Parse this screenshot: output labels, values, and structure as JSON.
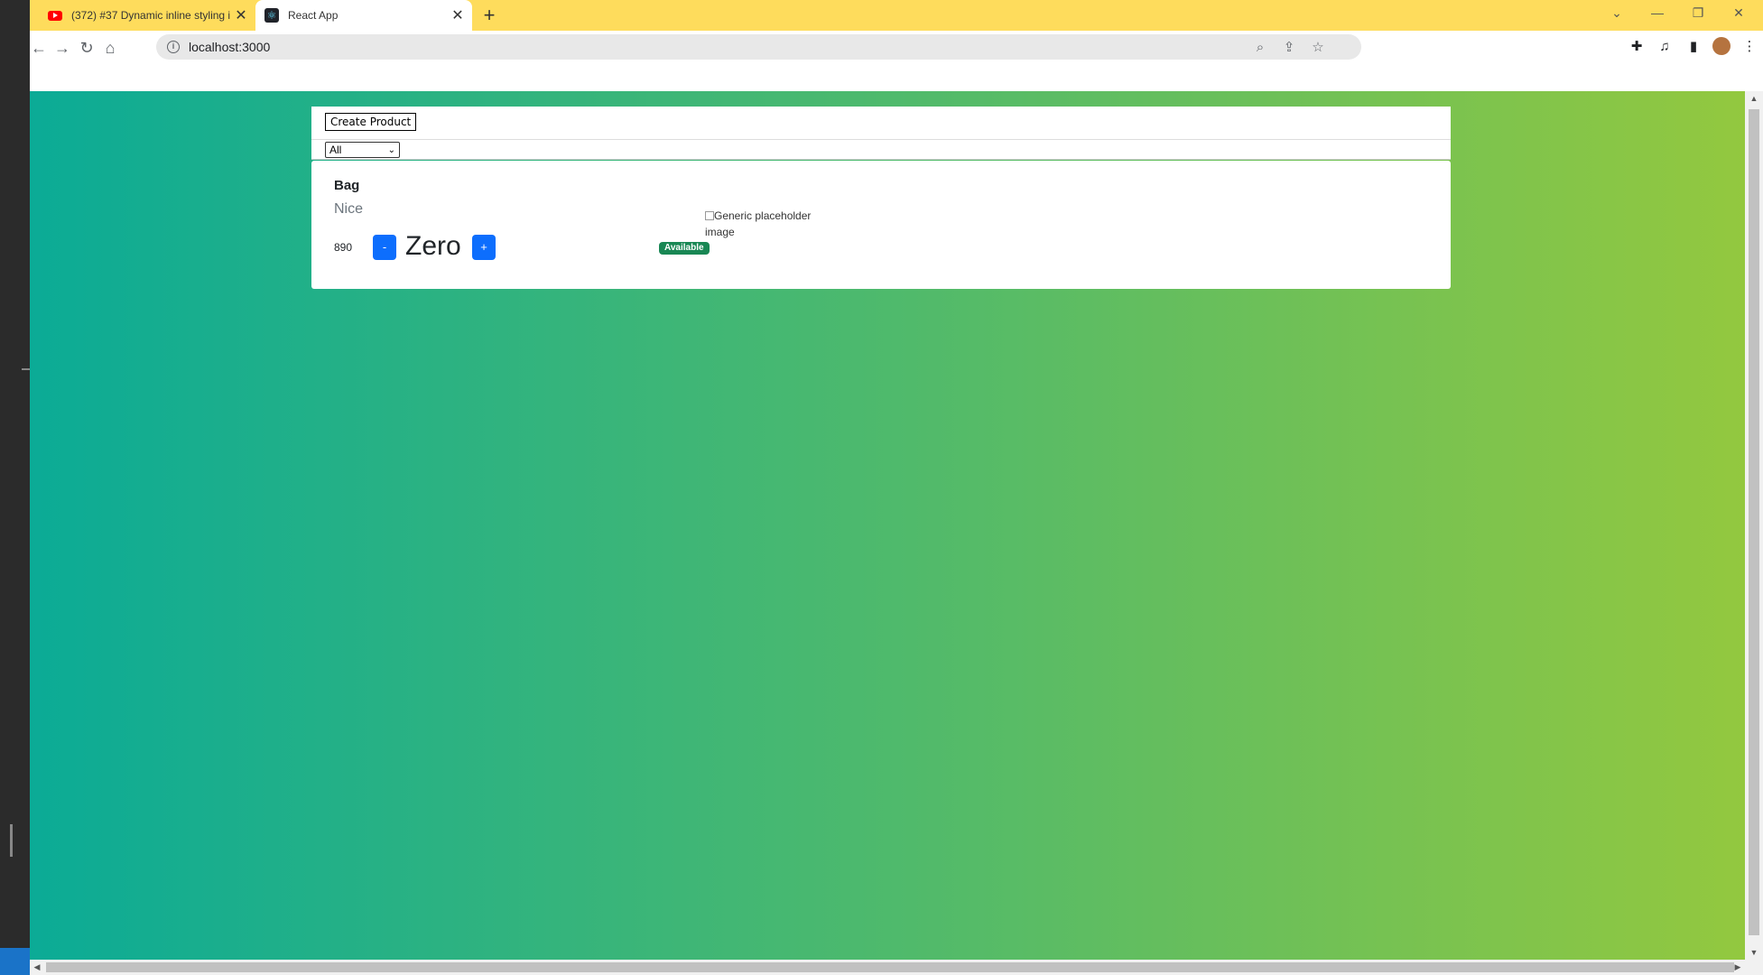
{
  "browser": {
    "tabs": [
      {
        "title": "(372) #37 Dynamic inline styling i",
        "icon": "youtube-icon",
        "active": false
      },
      {
        "title": "React App",
        "icon": "react-icon",
        "active": true
      }
    ],
    "url": "localhost:3000"
  },
  "app": {
    "create_button_label": "Create Product",
    "filter": {
      "selected": "All"
    },
    "product": {
      "name": "Bag",
      "description": "Nice",
      "price": "890",
      "decrement_label": "-",
      "quantity": "Zero",
      "increment_label": "+",
      "status_badge": "Available",
      "image_alt": "Generic placeholder image"
    }
  },
  "colors": {
    "tab_strip": "#fedc5c",
    "gradient_start": "#0bab96",
    "gradient_end": "#93c83f",
    "button_primary": "#0d6efd",
    "badge_success": "#198754"
  }
}
